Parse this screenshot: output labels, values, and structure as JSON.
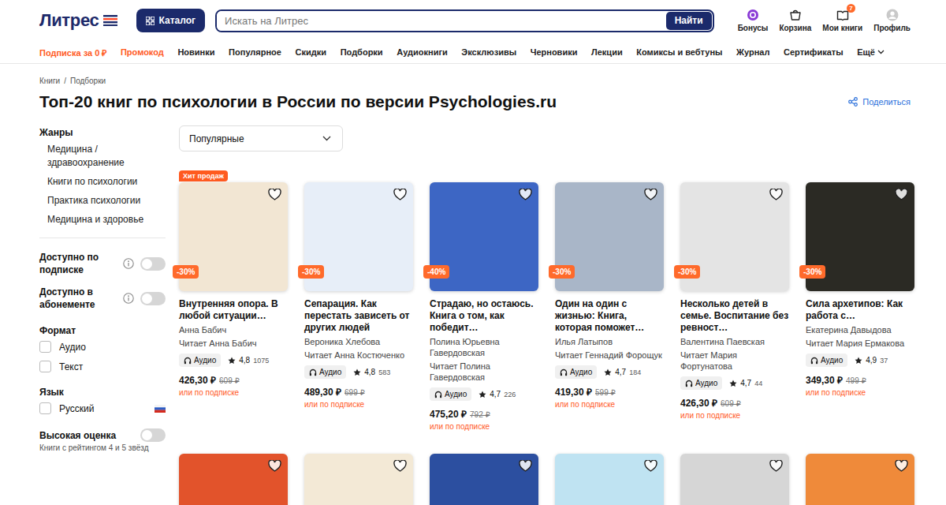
{
  "header": {
    "logo": "Литрес",
    "catalog_button": "Каталог",
    "search": {
      "placeholder": "Искать на Литрес",
      "button": "Найти"
    },
    "actions": [
      {
        "label": "Бонусы",
        "icon": "bonus",
        "badge": ""
      },
      {
        "label": "Корзина",
        "icon": "cart",
        "badge": ""
      },
      {
        "label": "Мои книги",
        "icon": "books",
        "badge": "7"
      },
      {
        "label": "Профиль",
        "icon": "profile",
        "badge": ""
      }
    ]
  },
  "nav": [
    {
      "label": "Подписка за 0 ₽",
      "highlight": true
    },
    {
      "label": "Промокод",
      "highlight": true
    },
    {
      "label": "Новинки",
      "highlight": false
    },
    {
      "label": "Популярное",
      "highlight": false
    },
    {
      "label": "Скидки",
      "highlight": false
    },
    {
      "label": "Подборки",
      "highlight": false
    },
    {
      "label": "Аудиокниги",
      "highlight": false
    },
    {
      "label": "Эксклюзивы",
      "highlight": false
    },
    {
      "label": "Черновики",
      "highlight": false
    },
    {
      "label": "Лекции",
      "highlight": false
    },
    {
      "label": "Комиксы и вебтуны",
      "highlight": false
    },
    {
      "label": "Журнал",
      "highlight": false
    },
    {
      "label": "Сертификаты",
      "highlight": false
    },
    {
      "label": "Ещё",
      "highlight": false
    }
  ],
  "breadcrumbs": [
    "Книги",
    "Подборки"
  ],
  "breadcrumb_separator": "/",
  "title": "Топ-20 книг по психологии в России по версии Psychologies.ru",
  "share": "Поделиться",
  "sidebar": {
    "genres_title": "Жанры",
    "genres": [
      "Медицина / здравоохранение",
      "Книги по психологии",
      "Практика психологии",
      "Медицина и здоровье"
    ],
    "toggles": [
      {
        "label": "Доступно по подписке",
        "on": false
      },
      {
        "label": "Доступно в абонементе",
        "on": false
      }
    ],
    "format_title": "Формат",
    "formats": [
      {
        "label": "Аудио",
        "checked": false
      },
      {
        "label": "Текст",
        "checked": false
      }
    ],
    "language_title": "Язык",
    "languages": [
      {
        "label": "Русский",
        "checked": false
      }
    ],
    "rating_filter": {
      "label": "Высокая оценка",
      "hint": "Книги с рейтингом 4 и 5 звёзд",
      "on": false
    }
  },
  "sort": {
    "value": "Популярные"
  },
  "books": [
    {
      "badge": "Хит продаж",
      "discount": "-30%",
      "title": "Внутренняя опора. В любой ситуации…",
      "author": "Анна Бабич",
      "reader": "Читает Анна Бабич",
      "format": "Аудио",
      "rating": "4,8",
      "votes": "1075",
      "price": "426,30 ₽",
      "old_price": "609 ₽",
      "subscription": "или по подписке",
      "favorite": false,
      "color": "#f2e6d3"
    },
    {
      "badge": "",
      "discount": "-30%",
      "title": "Сепарация. Как перестать зависеть от других людей",
      "author": "Вероника Хлебова",
      "reader": "Читает Анна Костюченко",
      "format": "Аудио",
      "rating": "4,8",
      "votes": "583",
      "price": "489,30 ₽",
      "old_price": "699 ₽",
      "subscription": "или по подписке",
      "favorite": false,
      "color": "#e7eef8"
    },
    {
      "badge": "",
      "discount": "-40%",
      "title": "Страдаю, но остаюсь. Книга о том, как победит…",
      "author": "Полина Юрьевна Гавердовская",
      "reader": "Читает Полина Гавердовская",
      "format": "Аудио",
      "rating": "4,7",
      "votes": "226",
      "price": "475,20 ₽",
      "old_price": "792 ₽",
      "subscription": "или по подписке",
      "favorite": false,
      "color": "#3d66c4"
    },
    {
      "badge": "",
      "discount": "-30%",
      "title": "Один на один с жизнью: Книга, которая поможет…",
      "author": "Илья Латыпов",
      "reader": "Читает Геннадий Форощук",
      "format": "Аудио",
      "rating": "4,7",
      "votes": "184",
      "price": "419,30 ₽",
      "old_price": "599 ₽",
      "subscription": "или по подписке",
      "favorite": false,
      "color": "#a9b6c8"
    },
    {
      "badge": "",
      "discount": "-30%",
      "title": "Несколько детей в семье. Воспитание без ревност…",
      "author": "Валентина Паевская",
      "reader": "Читает Мария Фортунатова",
      "format": "Аудио",
      "rating": "4,7",
      "votes": "44",
      "price": "426,30 ₽",
      "old_price": "609 ₽",
      "subscription": "или по подписке",
      "favorite": false,
      "color": "#e4e4e4"
    },
    {
      "badge": "",
      "discount": "-30%",
      "title": "Сила архетипов: Как работа с…",
      "author": "Екатерина Давыдова",
      "reader": "Читает Мария Ермакова",
      "format": "Аудио",
      "rating": "4,9",
      "votes": "37",
      "price": "349,30 ₽",
      "old_price": "499 ₽",
      "subscription": "или по подписке",
      "favorite": false,
      "color": "#2b2a24"
    }
  ],
  "books_next_row": [
    {
      "favorite": false,
      "color": "#e2532b"
    },
    {
      "favorite": false,
      "color": "#f3e9d6"
    },
    {
      "favorite": false,
      "color": "#2c4fa0"
    },
    {
      "favorite": false,
      "color": "#bfe3f2"
    },
    {
      "favorite": false,
      "color": "#d6d6d6"
    },
    {
      "favorite": false,
      "color": "#ef8a3a"
    }
  ]
}
